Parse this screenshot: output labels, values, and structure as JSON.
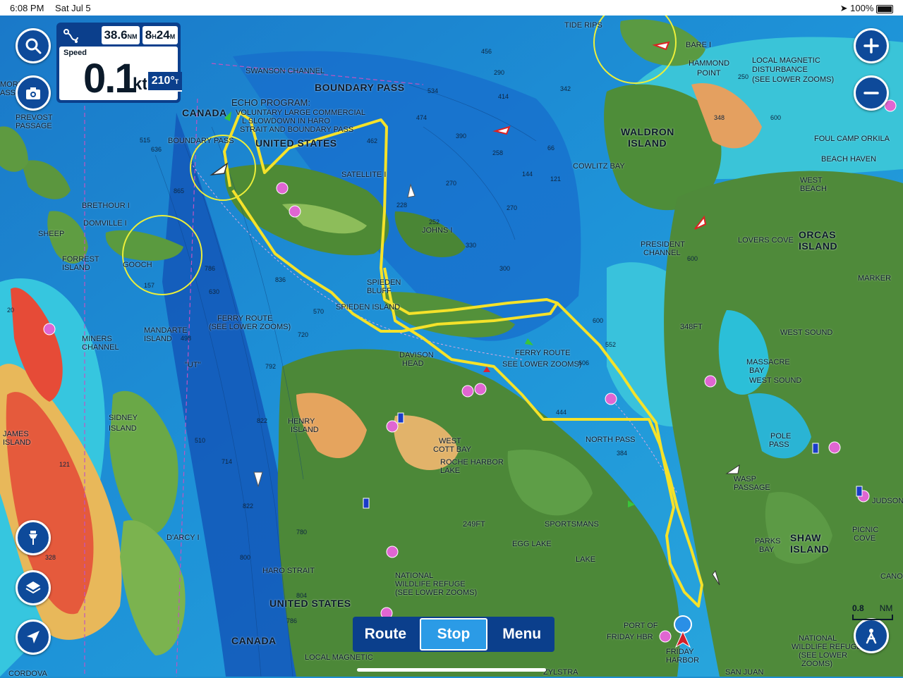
{
  "status_bar": {
    "time": "6:08 PM",
    "date": "Sat Jul 5",
    "battery": "100%"
  },
  "nav_panel": {
    "distance_value": "38.6",
    "distance_unit": "NM",
    "time_hours": "8",
    "time_hours_unit": "H",
    "time_minutes": "24",
    "time_minutes_unit": "M",
    "speed_label": "Speed",
    "speed_value": "0.1",
    "speed_unit": "kts",
    "heading_value": "210°",
    "heading_unit": "T"
  },
  "bottom_bar": {
    "route": "Route",
    "stop": "Stop",
    "menu": "Menu",
    "active": "Stop"
  },
  "scale": {
    "value": "0.8",
    "unit": "NM"
  },
  "map_labels": {
    "canada_north": "CANADA",
    "united_states_north": "UNITED STATES",
    "boundary_pass": "BOUNDARY PASS",
    "echo_program": "ECHO PROGRAM:",
    "echo_line1": "VOLUNTARY LARGE COMMERCIAL",
    "echo_line2": "L SLOWDOWN IN HARO",
    "echo_line3": "STRAIT AND BOUNDARY PASS",
    "boundary_pass_small": "BOUNDARY PASS",
    "swanson_channel": "SWANSON CHANNEL",
    "tide_rips": "TIDE RIPS",
    "barnes": "BARE I",
    "hammond_point1": "HAMMOND",
    "hammond_point2": "POINT",
    "local_mag1": "LOCAL MAGNETIC",
    "local_mag2": "DISTURBANCE",
    "local_mag3": "(SEE LOWER ZOOMS)",
    "waldron1": "WALDRON",
    "waldron2": "ISLAND",
    "cowlitz_bay": "COWLITZ BAY",
    "foul_camp": "FOUL CAMP ORKILA",
    "beach_haven": "BEACH HAVEN",
    "west_beach1": "WEST",
    "west_beach2": "BEACH",
    "orcas1": "ORCAS",
    "orcas2": "ISLAND",
    "lovers_cove": "LOVERS COVE",
    "president1": "PRESIDENT",
    "president2": "CHANNEL",
    "marker": "MARKER",
    "satellite": "SATELLITE I",
    "johns": "JOHNS I",
    "spieden_bluff1": "SPIEDEN",
    "spieden_bluff2": "BLUFF",
    "spieden_island": "SPIEDEN ISLAND",
    "prevost1": "PREVOST",
    "prevost2": "PASSAGE",
    "moresby1": "MORE",
    "moresby2": "ASS",
    "brethour": "BRETHOUR I",
    "domville": "DOMVILLE I",
    "sheep": "SHEEP",
    "forrest1": "FORREST",
    "forrest2": "ISLAND",
    "gooch": "GOOCH",
    "mandarte1": "MANDARTE",
    "mandarte2": "ISLAND",
    "miners1": "MINERS",
    "miners2": "CHANNEL",
    "ferry_route1": "FERRY ROUTE",
    "ferry_route2": "(SEE LOWER ZOOMS)",
    "ferry_route3": "FERRY ROUTE",
    "ferry_route4": "SEE LOWER ZOOMS)",
    "ut": "\"UT\"",
    "sidney1": "SIDNEY",
    "sidney2": "ISLAND",
    "james1": "JAMES",
    "james2": "ISLAND",
    "darcy": "D'ARCY I",
    "haro_strait": "HARO STRAIT",
    "united_states_south": "UNITED STATES",
    "canada_south": "CANADA",
    "local_magnetic_bottom": "LOCAL MAGNETIC",
    "cordova": "CORDOVA",
    "davison1": "DAVISON",
    "davison2": "HEAD",
    "henry1": "HENRY",
    "henry2": "ISLAND",
    "west_cott1": "WEST",
    "west_cott2": "COTT BAY",
    "roche1": "ROCHE HARBOR",
    "roche2": "LAKE",
    "depth_249": "249FT",
    "sportsmans": "SPORTSMANS",
    "egg_lake": "EGG LAKE",
    "lake": "LAKE",
    "nwr1": "NATIONAL",
    "nwr2": "WILDLIFE REFUGE",
    "nwr3": "(SEE LOWER ZOOMS)",
    "north_pass": "NORTH PASS",
    "west_sound": "WEST SOUND",
    "massacre1": "MASSACRE",
    "massacre2": "BAY",
    "west_sound2": "WEST SOUND",
    "pole1": "POLE",
    "pole2": "PASS",
    "wasp1": "WASP",
    "wasp2": "PASSAGE",
    "shaw1": "SHAW",
    "shaw2": "ISLAND",
    "parks1": "PARKS",
    "parks2": "BAY",
    "picnic1": "PICNIC",
    "picnic2": "COVE",
    "judson": "JUDSON",
    "canoe": "CANOE",
    "port_of1": "PORT OF",
    "port_of2": "FRIDAY HBR",
    "friday1": "FRIDAY",
    "friday2": "HARBOR",
    "san_juan": "SAN JUAN",
    "zylstra": "ZYLSTRA",
    "nwr_b1": "NATIONAL",
    "nwr_b2": "WILDLIFE REFUGE",
    "nwr_b3": "(SEE LOWER",
    "nwr_b4": "ZOOMS)",
    "depth_348": "348FT"
  },
  "depths": [
    "456",
    "534",
    "474",
    "390",
    "414",
    "342",
    "290",
    "462",
    "270",
    "228",
    "252",
    "330",
    "300",
    "270",
    "144",
    "121",
    "66",
    "600",
    "552",
    "600",
    "606",
    "570",
    "720",
    "792",
    "822",
    "714",
    "780",
    "800",
    "822",
    "786",
    "804",
    "630",
    "786",
    "836",
    "498",
    "515",
    "636",
    "865",
    "157",
    "121",
    "20",
    "328",
    "510",
    "384",
    "444",
    "600",
    "348",
    "250",
    "258"
  ],
  "colors": {
    "panel_blue": "#0b3f8c",
    "active_blue": "#2b9be6",
    "track_yellow": "#f5e22a",
    "deep_water": "#1565c8",
    "shallow_water": "#2fc2e0",
    "land_green": "#4f8a3a",
    "marsh": "#d7c56a",
    "red_flat": "#e0483a"
  },
  "icons": {
    "search": "search-icon",
    "camera": "camera-icon",
    "zoom_in": "plus-icon",
    "zoom_out": "minus-icon",
    "pin": "pin-icon",
    "layers": "layers-icon",
    "navigate": "navigation-arrow-icon",
    "person": "person-icon",
    "route": "route-icon",
    "location": "location-arrow-icon"
  }
}
